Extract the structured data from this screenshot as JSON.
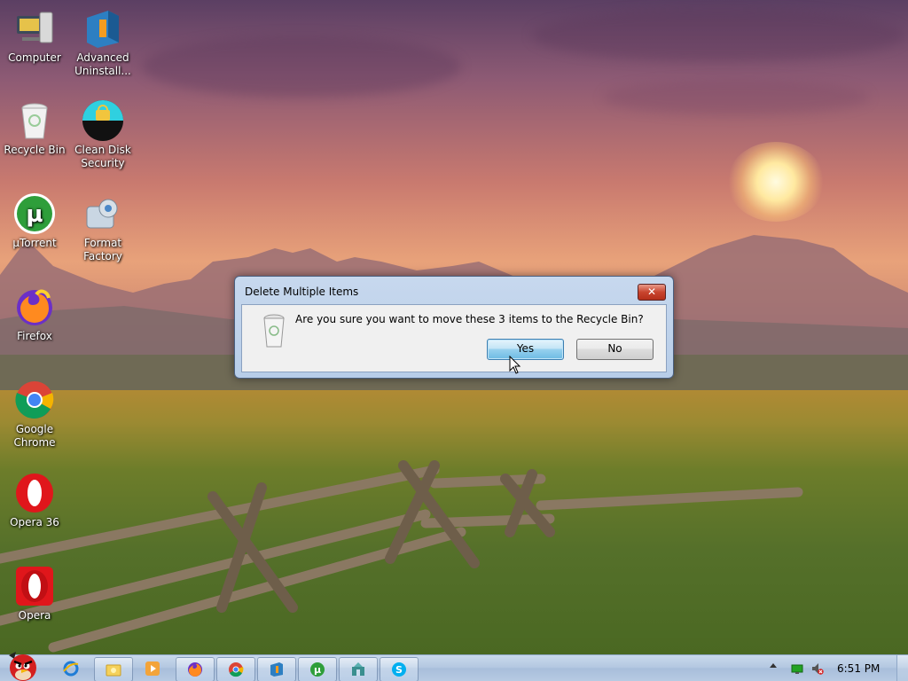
{
  "desktop": {
    "icons": [
      {
        "label_lines": [
          "Computer"
        ],
        "icon": "computer-icon"
      },
      {
        "label_lines": [
          "Advanced",
          "Uninstall..."
        ],
        "icon": "advanced-uninstaller-icon"
      },
      {
        "label_lines": [
          "Recycle Bin"
        ],
        "icon": "recycle-bin-icon"
      },
      {
        "label_lines": [
          "Clean Disk",
          "Security"
        ],
        "icon": "clean-disk-security-icon"
      },
      {
        "label_lines": [
          "µTorrent"
        ],
        "icon": "utorrent-icon"
      },
      {
        "label_lines": [
          "Format",
          "Factory"
        ],
        "icon": "format-factory-icon"
      },
      {
        "label_lines": [
          "Firefox"
        ],
        "icon": "firefox-icon"
      },
      {
        "label_lines": [
          "Google",
          "Chrome"
        ],
        "icon": "google-chrome-icon"
      },
      {
        "label_lines": [
          "Opera 36"
        ],
        "icon": "opera-36-icon"
      },
      {
        "label_lines": [
          "Opera"
        ],
        "icon": "opera-icon"
      }
    ]
  },
  "dialog": {
    "title": "Delete Multiple Items",
    "close_label": "✕",
    "message": "Are you sure you want to move these 3 items to the Recycle Bin?",
    "yes_label": "Yes",
    "no_label": "No"
  },
  "taskbar": {
    "start_icon": "angry-birds-start-icon",
    "items": [
      {
        "icon": "internet-explorer-icon",
        "pinned_style": "plain"
      },
      {
        "icon": "folder-icon",
        "pinned_style": "button"
      },
      {
        "icon": "media-player-icon",
        "pinned_style": "plain"
      },
      {
        "icon": "firefox-icon",
        "pinned_style": "button"
      },
      {
        "icon": "google-chrome-icon",
        "pinned_style": "button"
      },
      {
        "icon": "advanced-uninstaller-icon",
        "pinned_style": "button"
      },
      {
        "icon": "utorrent-icon",
        "pinned_style": "button"
      },
      {
        "icon": "app-icon",
        "pinned_style": "button"
      },
      {
        "icon": "skype-icon",
        "pinned_style": "button"
      }
    ],
    "tray": {
      "icons": [
        "show-hidden-icons",
        "network-icon",
        "volume-muted-icon"
      ]
    },
    "clock": "6:51 PM"
  },
  "colors": {
    "dialog_frame": "#b7cde8",
    "dialog_close": "#c8442e",
    "default_button": "#98d1ef",
    "taskbar": "#b4c8e1"
  }
}
